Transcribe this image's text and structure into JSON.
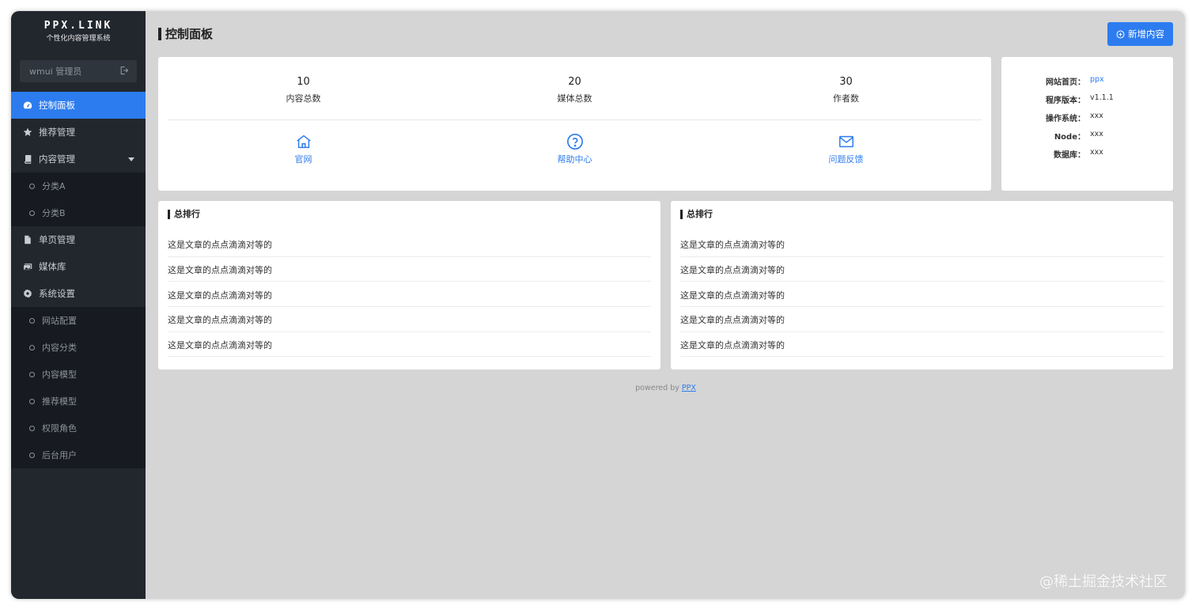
{
  "brand": {
    "title": "PPX.LINK",
    "subtitle": "个性化内容管理系统"
  },
  "user": {
    "label": "wmui 管理员"
  },
  "sidebar": {
    "items": [
      {
        "label": "控制面板",
        "icon": "dashboard-icon",
        "active": true
      },
      {
        "label": "推荐管理",
        "icon": "star-icon"
      },
      {
        "label": "内容管理",
        "icon": "book-icon",
        "expanded": true,
        "children": [
          "分类A",
          "分类B"
        ]
      },
      {
        "label": "单页管理",
        "icon": "file-icon"
      },
      {
        "label": "媒体库",
        "icon": "images-icon"
      },
      {
        "label": "系统设置",
        "icon": "gear-icon",
        "expanded": true,
        "children": [
          "网站配置",
          "内容分类",
          "内容模型",
          "推荐模型",
          "权限角色",
          "后台用户"
        ]
      }
    ]
  },
  "header": {
    "title": "控制面板",
    "add_label": "新增内容"
  },
  "stats": [
    {
      "value": "10",
      "label": "内容总数"
    },
    {
      "value": "20",
      "label": "媒体总数"
    },
    {
      "value": "30",
      "label": "作者数"
    }
  ],
  "links": [
    {
      "label": "官网",
      "icon": "home-icon"
    },
    {
      "label": "帮助中心",
      "icon": "help-circle-icon"
    },
    {
      "label": "问题反馈",
      "icon": "mail-icon"
    }
  ],
  "info": [
    {
      "key": "网站首页：",
      "value": "ppx",
      "link": true
    },
    {
      "key": "程序版本：",
      "value": "v1.1.1"
    },
    {
      "key": "操作系统：",
      "value": "xxx"
    },
    {
      "key": "Node：",
      "value": "xxx"
    },
    {
      "key": "数据库：",
      "value": "xxx"
    }
  ],
  "rankings": [
    {
      "title": "总排行",
      "items": [
        "这是文章的点点滴滴对等的",
        "这是文章的点点滴滴对等的",
        "这是文章的点点滴滴对等的",
        "这是文章的点点滴滴对等的",
        "这是文章的点点滴滴对等的"
      ]
    },
    {
      "title": "总排行",
      "items": [
        "这是文章的点点滴滴对等的",
        "这是文章的点点滴滴对等的",
        "这是文章的点点滴滴对等的",
        "这是文章的点点滴滴对等的",
        "这是文章的点点滴滴对等的"
      ]
    }
  ],
  "footer": {
    "prefix": "powered by",
    "link": "PPX"
  },
  "watermark": "@稀土掘金技术社区",
  "colors": {
    "accent": "#2c7cf0",
    "sidebar": "#22272e",
    "submenu": "#171b21",
    "background": "#d5d5d5"
  }
}
